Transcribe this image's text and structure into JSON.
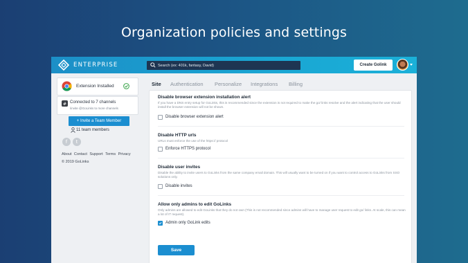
{
  "hero": {
    "title": "Organization policies and settings"
  },
  "topbar": {
    "brand": "ENTERPRISE",
    "search_placeholder": "Search (ex: 401k, fantasy, David)",
    "create_label": "Create Golink"
  },
  "sidebar": {
    "extension_status": "Extension Installed",
    "slack_connected": "Connected to 7 channels",
    "slack_hint": "/invite @GoLinks to more channels",
    "invite_label": "+ Invite a Team Member",
    "team_members": "11 team members",
    "social": {
      "facebook": "f",
      "twitter": "t"
    },
    "footer_links": [
      "About",
      "Contact",
      "Support",
      "Terms",
      "Privacy"
    ],
    "copyright": "© 2019 GoLinks"
  },
  "tabs": [
    "Site",
    "Authentication",
    "Personalize",
    "Integrations",
    "Billing"
  ],
  "active_tab": "Site",
  "sections": [
    {
      "title": "Disable browser extension installation alert",
      "description": "If you have a DNS entry setup for GoLinks, this is recommended since the extension is not required to make the go/ links resolve and the alert indicating that the user should install the browser extension will not be shown.",
      "checkbox_label": "Disable browser extension alert",
      "checked": false
    },
    {
      "title": "Disable HTTP urls",
      "description": "URLs must enforce the use of the https:// protocol",
      "checkbox_label": "Enforce HTTPS protocol",
      "checked": false
    },
    {
      "title": "Disable user invites",
      "description": "Disable the ability to invite users to GoLinks from the same company email domain. This will usually want to be turned on if you want to control access to GoLinks from SSO solutions only.",
      "checkbox_label": "Disable invites",
      "checked": false
    },
    {
      "title": "Allow only admins to edit GoLinks",
      "description": "Only admins are allowed to edit GoLinks that they do not own (This is not recommended since admins will have to manage user request to edit go/ links. At scale, this can mean a lot of IT request).",
      "checkbox_label": "Admin only GoLink edits",
      "checked": true
    }
  ],
  "save_label": "Save",
  "colors": {
    "accent": "#1b8ed0",
    "topbar": "#1aa6d3",
    "search_bg": "#1e3552"
  }
}
